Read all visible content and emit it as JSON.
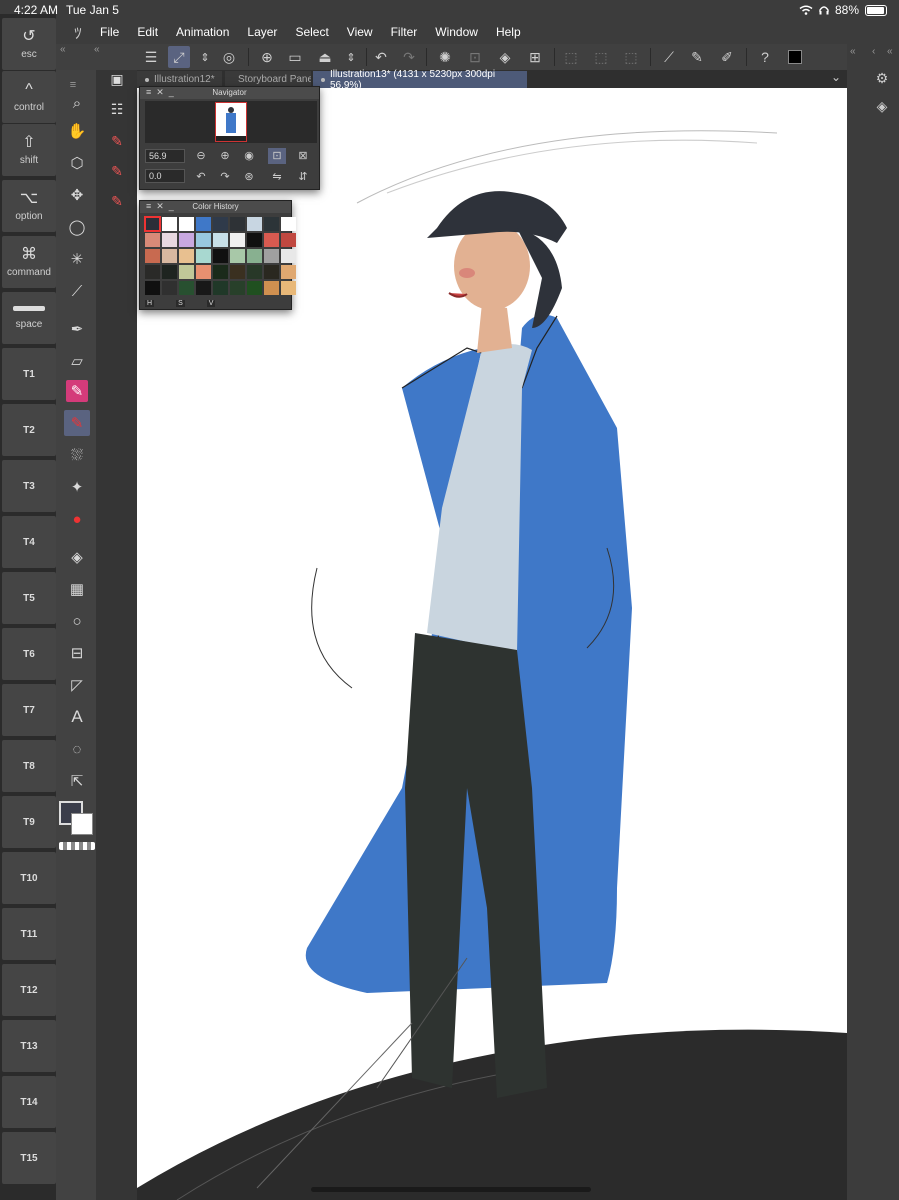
{
  "status": {
    "time": "4:22 AM",
    "date": "Tue Jan 5",
    "battery": "88%",
    "battery_level": 0.88
  },
  "keys": [
    {
      "label": "esc",
      "icon": "undo-icon",
      "glyph": "↺"
    },
    {
      "label": "control",
      "icon": "control-icon",
      "glyph": "^"
    },
    {
      "label": "shift",
      "icon": "shift-icon",
      "glyph": "⇧"
    },
    {
      "label": "option",
      "icon": "option-icon",
      "glyph": "⌥"
    },
    {
      "label": "command",
      "icon": "command-icon",
      "glyph": "⌘"
    },
    {
      "label": "space",
      "icon": "space-bar-icon",
      "glyph": ""
    }
  ],
  "tkeys": [
    "T1",
    "T2",
    "T3",
    "T4",
    "T5",
    "T6",
    "T7",
    "T8",
    "T9",
    "T10",
    "T11",
    "T12",
    "T13",
    "T14",
    "T15"
  ],
  "menu": [
    "File",
    "Edit",
    "Animation",
    "Layer",
    "Select",
    "View",
    "Filter",
    "Window",
    "Help"
  ],
  "tabs": [
    {
      "label": "Illustration12*"
    },
    {
      "label": "Storyboard Pane"
    },
    {
      "label": "Illustration13* (4131 x 5230px 300dpi 56.9%)"
    }
  ],
  "navigator": {
    "title": "Navigator",
    "zoom": "56.9",
    "rotation": "0.0"
  },
  "color_history": {
    "title": "Color History",
    "hsv_labels": [
      "H",
      "S",
      "V"
    ],
    "swatches": [
      "#2b2e38",
      "#ffffff",
      "#ffffff",
      "#3f78c8",
      "#2f3a4a",
      "#2e3236",
      "#c8d6e2",
      "#2c3438",
      "#ffffff",
      "#d98a78",
      "#e8d8e0",
      "#c8a8e0",
      "#98c8e0",
      "#c8e0e8",
      "#f0f0f0",
      "#101010",
      "#d85a50",
      "#c04840",
      "#c86a50",
      "#d8b8a0",
      "#e8c090",
      "#a8d8d0",
      "#101010",
      "#a8c8a8",
      "#88b090",
      "#a0a0a0",
      "#e8e8e8",
      "#2a2a28",
      "#1e2420",
      "#c0c898",
      "#e89070",
      "#1a2a1a",
      "#3a3020",
      "#283828",
      "#2a2820",
      "#e0a870",
      "#101010",
      "#303030",
      "#285030",
      "#181818",
      "#203828",
      "#28402a",
      "#205020",
      "#d09050",
      "#e8b878"
    ]
  },
  "colors": {
    "accent": "#5a6380",
    "coat": "#3f78c8",
    "main_color": "#3a3d4a",
    "sub_color": "#ffffff"
  }
}
